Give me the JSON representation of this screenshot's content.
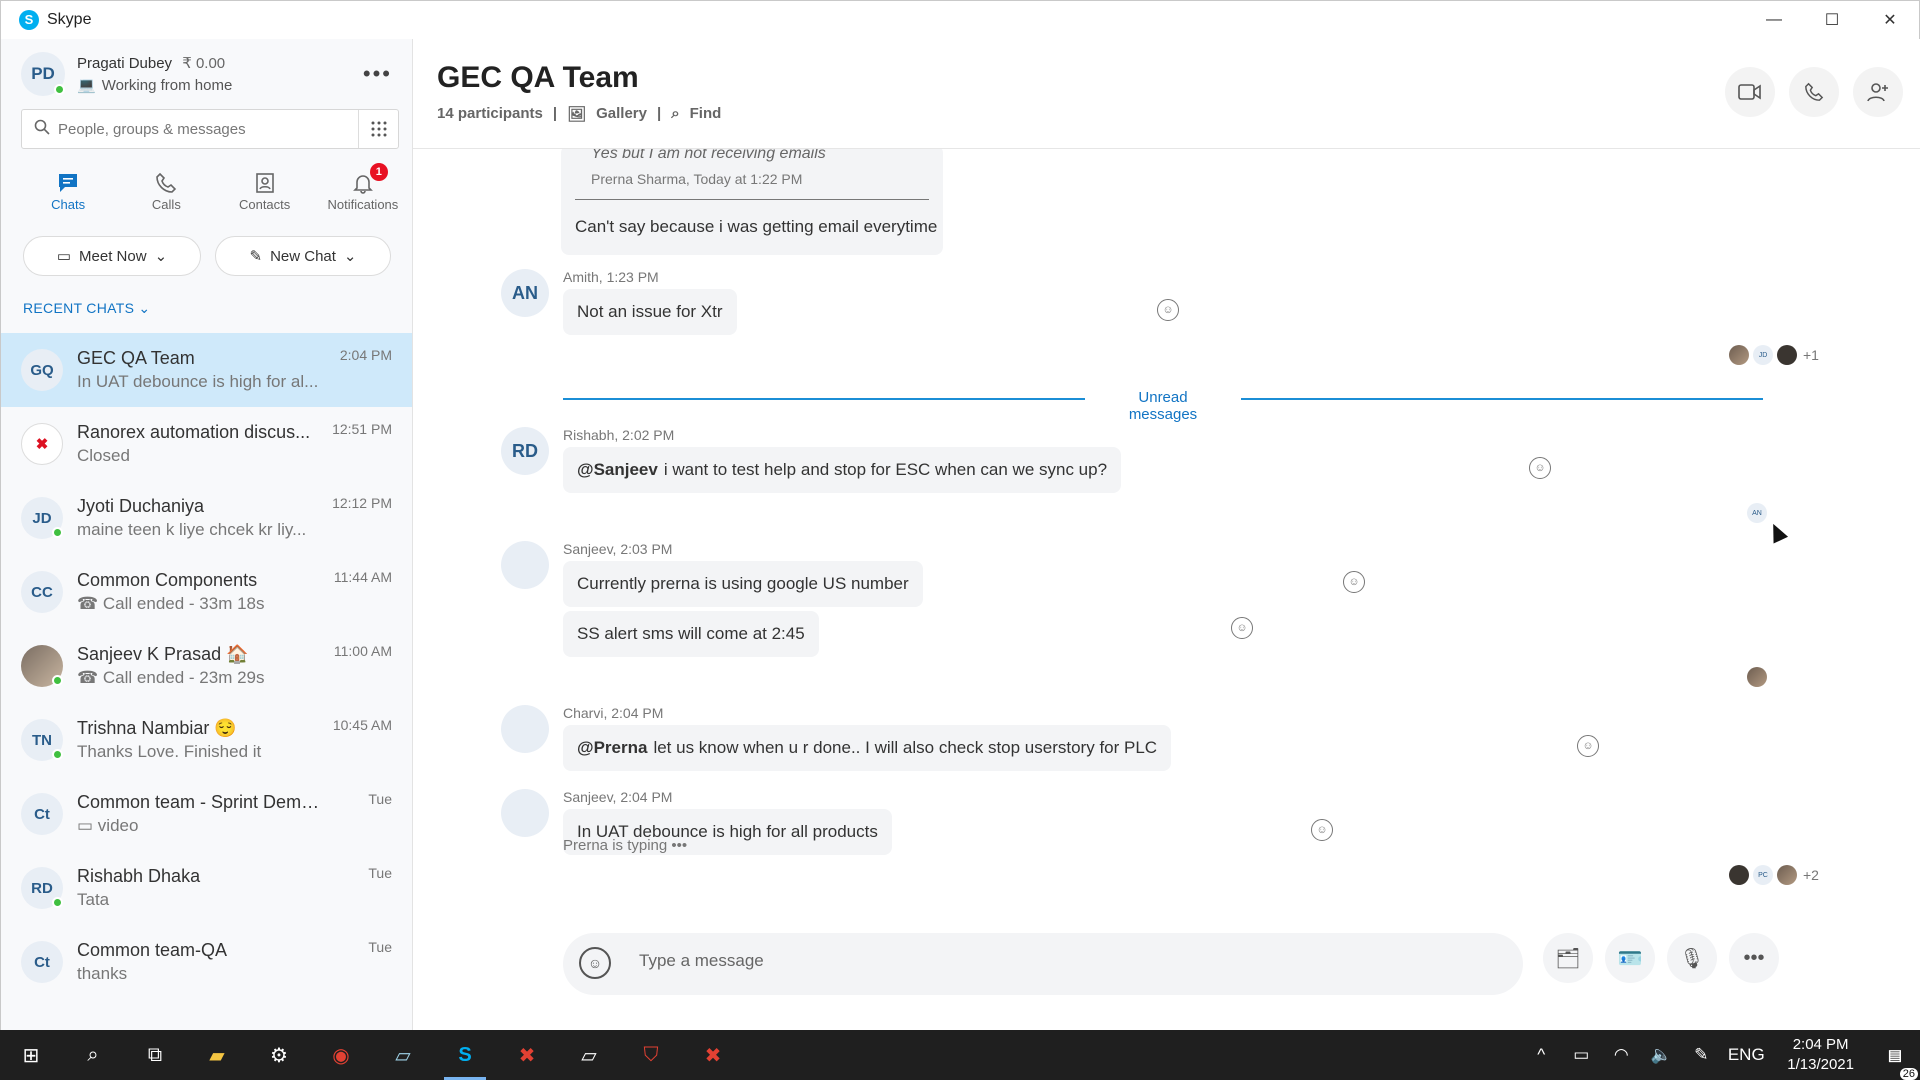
{
  "window": {
    "app_title": "Skype",
    "app_logo": "S"
  },
  "profile": {
    "initials": "PD",
    "name": "Pragati Dubey",
    "balance": "₹ 0.00",
    "status": "Working from home"
  },
  "search": {
    "placeholder": "People, groups & messages"
  },
  "nav": [
    {
      "label": "Chats",
      "icon": "chat-icon",
      "active": true
    },
    {
      "label": "Calls",
      "icon": "phone-icon"
    },
    {
      "label": "Contacts",
      "icon": "contacts-icon"
    },
    {
      "label": "Notifications",
      "icon": "bell-icon",
      "badge": "1"
    }
  ],
  "actions": {
    "meet_now": "Meet Now",
    "new_chat": "New Chat"
  },
  "recent_label": "RECENT CHATS",
  "chats": [
    {
      "initials": "GQ",
      "title": "GEC QA Team",
      "subtitle": "In UAT debounce is high for al...",
      "time": "2:04 PM"
    },
    {
      "initials": "Rx",
      "title": "Ranorex automation discus...",
      "subtitle": "Closed",
      "time": "12:51 PM"
    },
    {
      "initials": "JD",
      "title": "Jyoti Duchaniya",
      "subtitle": "maine teen k liye chcek kr liy...",
      "time": "12:12 PM"
    },
    {
      "initials": "CC",
      "title": "Common Components",
      "subtitle": "Call ended - 33m 18s",
      "time": "11:44 AM"
    },
    {
      "initials": "",
      "title": "Sanjeev K Prasad 🏠",
      "subtitle": "Call ended - 23m 29s",
      "time": "11:00 AM"
    },
    {
      "initials": "TN",
      "title": "Trishna Nambiar 😌",
      "subtitle": "Thanks Love. Finished it",
      "time": "10:45 AM"
    },
    {
      "initials": "Ct",
      "title": "Common team - Sprint Demo d...",
      "subtitle": "video",
      "time": "Tue"
    },
    {
      "initials": "RD",
      "title": "Rishabh Dhaka",
      "subtitle": "Tata",
      "time": "Tue"
    },
    {
      "initials": "Ct",
      "title": "Common team-QA",
      "subtitle": "thanks",
      "time": "Tue"
    }
  ],
  "conversation": {
    "title": "GEC QA Team",
    "participants": "14 participants",
    "gallery": "Gallery",
    "find": "Find",
    "quote": {
      "text": "Yes but I am not receiving emails",
      "meta": "Prerna Sharma, Today at 1:22 PM",
      "reply": "Can't say because i was getting email everytime"
    },
    "unread_label": "Unread messages",
    "messages": [
      {
        "initials": "AN",
        "meta": "Amith, 1:23 PM",
        "bubbles": [
          {
            "text": "Not an issue for Xtr"
          }
        ]
      },
      {
        "initials": "RD",
        "meta": "Rishabh, 2:02 PM",
        "bubbles": [
          {
            "mention": "@Sanjeev",
            "text": "i want to test help and stop for ESC when can we sync up?"
          }
        ]
      },
      {
        "initials": "",
        "meta": "Sanjeev, 2:03 PM",
        "bubbles": [
          {
            "text": "Currently prerna is using google US number"
          },
          {
            "text": "SS alert sms will come at 2:45"
          }
        ]
      },
      {
        "initials": "",
        "meta": "Charvi, 2:04 PM",
        "bubbles": [
          {
            "mention": "@Prerna",
            "text": "let us know when u r done.. I will also check stop userstory for PLC"
          }
        ]
      },
      {
        "initials": "",
        "meta": "Sanjeev, 2:04 PM",
        "bubbles": [
          {
            "text": "In UAT debounce is high for all products"
          }
        ]
      }
    ],
    "read_receipts": [
      {
        "dots": [
          "",
          "JD",
          ""
        ],
        "more": "+1"
      },
      {
        "dots": [
          "AN"
        ],
        "more": ""
      },
      {
        "dots": [
          ""
        ],
        "more": ""
      },
      {
        "dots": [
          "",
          "PC",
          ""
        ],
        "more": "+2"
      }
    ],
    "typing": "Prerna is typing",
    "composer_placeholder": "Type a message"
  },
  "taskbar": {
    "time": "2:04 PM",
    "date": "1/13/2021",
    "lang": "ENG",
    "notifications": "26"
  }
}
